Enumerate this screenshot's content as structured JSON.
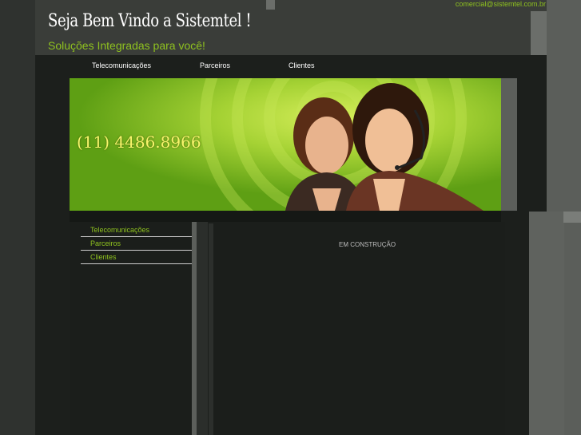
{
  "header": {
    "title": "Seja Bem Vindo a Sistemtel !",
    "subtitle": "Soluções Integradas para você!",
    "email": "comercial@sistemtel.com.br"
  },
  "nav": {
    "items": [
      {
        "label": "Telecomunicações"
      },
      {
        "label": "Parceiros"
      },
      {
        "label": "Clientes"
      }
    ]
  },
  "banner": {
    "phone": "(11) 4486.8966",
    "image": "call-center-women-headsets"
  },
  "sidebar": {
    "items": [
      {
        "label": "Telecomunicações"
      },
      {
        "label": "Parceiros"
      },
      {
        "label": "Clientes"
      }
    ]
  },
  "content": {
    "text": "EM CONSTRUÇÃO"
  },
  "colors": {
    "accent": "#8fc21f",
    "banner_green": "#6fae1a",
    "phone_yellow": "#f7f46b"
  }
}
